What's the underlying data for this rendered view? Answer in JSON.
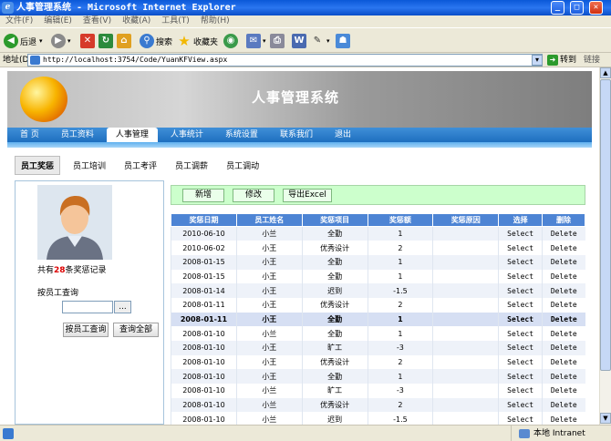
{
  "window": {
    "title": "人事管理系统 - Microsoft Internet Explorer",
    "menu": [
      "文件(F)",
      "编辑(E)",
      "查看(V)",
      "收藏(A)",
      "工具(T)",
      "帮助(H)"
    ]
  },
  "toolbar": {
    "back_label": "后退",
    "search_label": "搜索",
    "favorites_label": "收藏夹"
  },
  "address": {
    "label": "地址(D)",
    "url": "http://localhost:3754/Code/YuanKFView.aspx",
    "go_label": "转到",
    "links_label": "链接"
  },
  "status": {
    "zone": "本地 Intranet"
  },
  "header": {
    "system_title": "人事管理系统"
  },
  "nav": {
    "items": [
      "首 页",
      "员工资料",
      "人事管理",
      "人事统计",
      "系统设置",
      "联系我们",
      "退出"
    ],
    "active_index": 2
  },
  "subnav": {
    "items": [
      "员工奖惩",
      "员工培训",
      "员工考评",
      "员工调薪",
      "员工调动"
    ],
    "active_index": 0
  },
  "left": {
    "count_prefix": "共有",
    "count": "28",
    "count_suffix": "条奖惩记录",
    "query_label": "按员工查询",
    "dots_label": "...",
    "btn_query": "按员工查询",
    "btn_all": "查询全部"
  },
  "ops": {
    "add": "新增",
    "edit": "修改",
    "export": "导出Excel"
  },
  "table": {
    "headers": [
      "奖惩日期",
      "员工姓名",
      "奖惩项目",
      "奖惩额",
      "奖惩原因",
      "选择",
      "删除"
    ],
    "select_label": "Select",
    "delete_label": "Delete",
    "selected_row": 6,
    "rows": [
      [
        "2010-06-10",
        "小兰",
        "全勤",
        "1",
        ""
      ],
      [
        "2010-06-02",
        "小王",
        "优秀设计",
        "2",
        ""
      ],
      [
        "2008-01-15",
        "小王",
        "全勤",
        "1",
        ""
      ],
      [
        "2008-01-15",
        "小王",
        "全勤",
        "1",
        ""
      ],
      [
        "2008-01-14",
        "小王",
        "迟到",
        "-1.5",
        ""
      ],
      [
        "2008-01-11",
        "小王",
        "优秀设计",
        "2",
        ""
      ],
      [
        "2008-01-11",
        "小王",
        "全勤",
        "1",
        ""
      ],
      [
        "2008-01-10",
        "小兰",
        "全勤",
        "1",
        ""
      ],
      [
        "2008-01-10",
        "小王",
        "旷工",
        "-3",
        ""
      ],
      [
        "2008-01-10",
        "小王",
        "优秀设计",
        "2",
        ""
      ],
      [
        "2008-01-10",
        "小王",
        "全勤",
        "1",
        ""
      ],
      [
        "2008-01-10",
        "小兰",
        "旷工",
        "-3",
        ""
      ],
      [
        "2008-01-10",
        "小兰",
        "优秀设计",
        "2",
        ""
      ],
      [
        "2008-01-10",
        "小兰",
        "迟到",
        "-1.5",
        ""
      ]
    ]
  }
}
